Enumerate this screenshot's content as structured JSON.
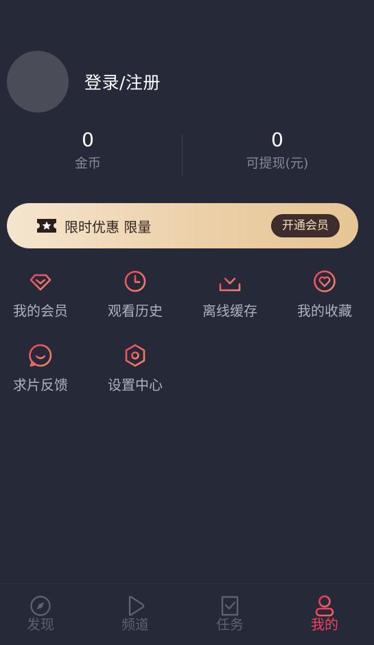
{
  "profile": {
    "login_text": "登录/注册"
  },
  "stats": [
    {
      "value": "0",
      "label": "金币"
    },
    {
      "value": "0",
      "label": "可提现(元)"
    }
  ],
  "banner": {
    "text": "限时优惠 限量",
    "button": "开通会员"
  },
  "menu": [
    {
      "label": "我的会员",
      "icon": "vip-diamond-icon"
    },
    {
      "label": "观看历史",
      "icon": "clock-icon"
    },
    {
      "label": "离线缓存",
      "icon": "download-icon"
    },
    {
      "label": "我的收藏",
      "icon": "heart-icon"
    },
    {
      "label": "求片反馈",
      "icon": "chat-bubble-icon"
    },
    {
      "label": "设置中心",
      "icon": "settings-hexagon-icon"
    }
  ],
  "tabs": [
    {
      "label": "发现",
      "icon": "compass-icon",
      "active": false
    },
    {
      "label": "频道",
      "icon": "play-icon",
      "active": false
    },
    {
      "label": "任务",
      "icon": "task-icon",
      "active": false
    },
    {
      "label": "我的",
      "icon": "user-icon",
      "active": true
    }
  ],
  "colors": {
    "background": "#252938",
    "accent": "#f2425e",
    "icon_gradient_start": "#f1425e",
    "icon_gradient_end": "#f48a6a",
    "banner_start": "#f5e5cf",
    "banner_end": "#e7c594"
  }
}
